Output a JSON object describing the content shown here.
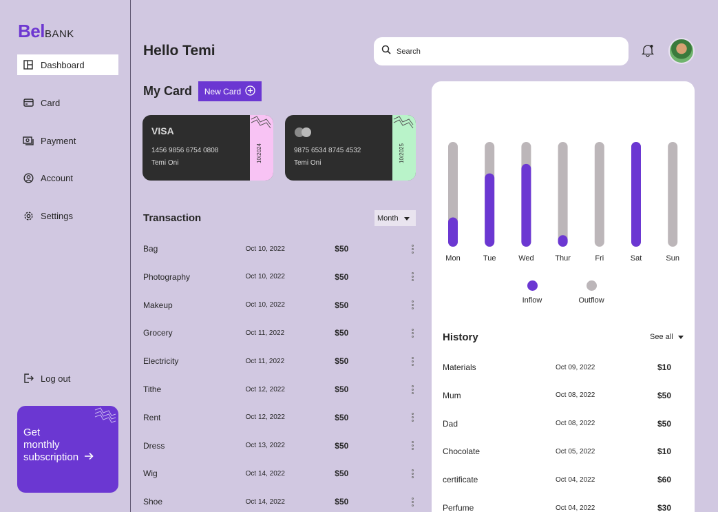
{
  "brand": {
    "logo_bold": "Bel",
    "logo_rest": "BANK",
    "accent": "#6b37d2"
  },
  "sidebar": {
    "items": [
      {
        "label": "Dashboard",
        "icon": "dashboard-icon",
        "active": true
      },
      {
        "label": "Card",
        "icon": "card-icon"
      },
      {
        "label": "Payment",
        "icon": "payment-icon"
      },
      {
        "label": "Account",
        "icon": "account-icon"
      },
      {
        "label": "Settings",
        "icon": "gear-icon"
      }
    ],
    "logout": "Log out",
    "promo": {
      "line1": "Get",
      "line2": "monthly",
      "line3": "subscription"
    }
  },
  "header": {
    "greeting": "Hello Temi",
    "search_placeholder": "Search"
  },
  "my_card": {
    "title": "My Card",
    "new_card_label": "New Card",
    "cards": [
      {
        "brand": "VISA",
        "number": "1456 9856 6754 0808",
        "holder": "Temi Oni",
        "expiry": "10/2024",
        "stripe_color": "#f8c3f4"
      },
      {
        "brand": "mastercard",
        "number": "9875 6534 8745 4532",
        "holder": "Temi Oni",
        "expiry": "10/2025",
        "stripe_color": "#b9f3c9"
      }
    ]
  },
  "transactions": {
    "title": "Transaction",
    "filter": "Month",
    "rows": [
      {
        "item": "Bag",
        "date": "Oct 10, 2022",
        "amount": "$50"
      },
      {
        "item": "Photography",
        "date": "Oct 10, 2022",
        "amount": "$50"
      },
      {
        "item": "Makeup",
        "date": "Oct 10, 2022",
        "amount": "$50"
      },
      {
        "item": "Grocery",
        "date": "Oct 11, 2022",
        "amount": "$50"
      },
      {
        "item": "Electricity",
        "date": "Oct 11, 2022",
        "amount": "$50"
      },
      {
        "item": "Tithe",
        "date": "Oct 12, 2022",
        "amount": "$50"
      },
      {
        "item": "Rent",
        "date": "Oct 12, 2022",
        "amount": "$50"
      },
      {
        "item": "Dress",
        "date": "Oct 13, 2022",
        "amount": "$50"
      },
      {
        "item": "Wig",
        "date": "Oct 14, 2022",
        "amount": "$50"
      },
      {
        "item": "Shoe",
        "date": "Oct 14, 2022",
        "amount": "$50"
      }
    ]
  },
  "chart_data": {
    "type": "bar",
    "categories": [
      "Mon",
      "Tue",
      "Wed",
      "Thur",
      "Fri",
      "Sat",
      "Sun"
    ],
    "series": [
      {
        "name": "Inflow",
        "values": [
          0.28,
          0.7,
          0.79,
          0.11,
          0,
          1.0,
          0
        ],
        "color": "#6b37d2"
      },
      {
        "name": "Outflow",
        "values": [
          1,
          1,
          1,
          1,
          1,
          1,
          1
        ],
        "color": "#bcb6b9"
      }
    ],
    "title": "",
    "xlabel": "",
    "ylabel": "",
    "ylim": [
      0,
      1
    ],
    "grid": false,
    "legend": "bottom"
  },
  "history": {
    "title": "History",
    "see_all": "See all",
    "rows": [
      {
        "item": "Materials",
        "date": "Oct 09, 2022",
        "amount": "$10"
      },
      {
        "item": "Mum",
        "date": "Oct 08, 2022",
        "amount": "$50"
      },
      {
        "item": "Dad",
        "date": "Oct 08, 2022",
        "amount": "$50"
      },
      {
        "item": "Chocolate",
        "date": "Oct 05, 2022",
        "amount": "$10"
      },
      {
        "item": "certificate",
        "date": "Oct 04, 2022",
        "amount": "$60"
      },
      {
        "item": "Perfume",
        "date": "Oct 04, 2022",
        "amount": "$30"
      }
    ]
  }
}
